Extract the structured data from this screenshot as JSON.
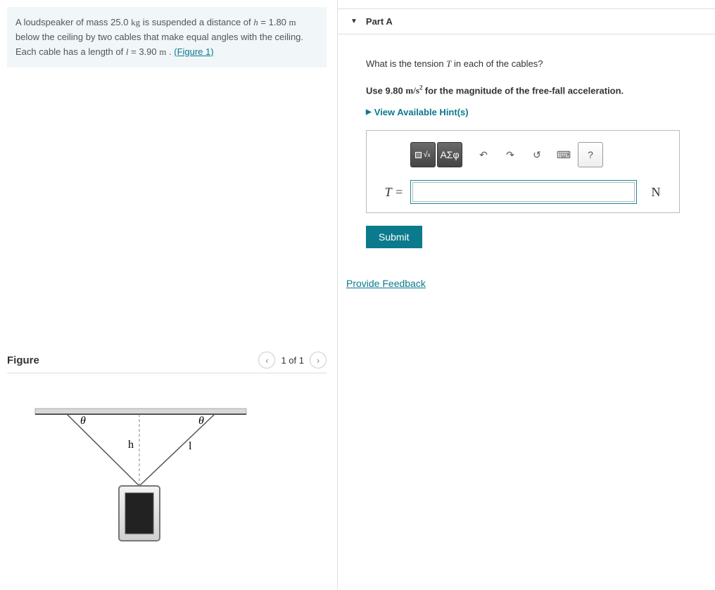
{
  "problem": {
    "prefix": "A loudspeaker of mass ",
    "mass": "25.0",
    "mass_unit": "kg",
    "mid1": " is suspended a distance of ",
    "h_var": "h",
    "h_eq": " = ",
    "h_val": "1.80",
    "h_unit": "m",
    "mid2": " below the ceiling by two cables that make equal angles with the ceiling. Each cable has a length of ",
    "l_var": "l",
    "l_eq": " = ",
    "l_val": "3.90",
    "l_unit": "m",
    "tail": " . ",
    "figure_link": "(Figure 1)"
  },
  "figure": {
    "title": "Figure",
    "nav_text": "1 of 1",
    "labels": {
      "theta_left": "θ",
      "theta_right": "θ",
      "h": "h",
      "l": "l"
    }
  },
  "partA": {
    "title": "Part A",
    "question_prefix": "What is the tension ",
    "tension_var": "T",
    "question_suffix": " in each of the cables?",
    "use_prefix": "Use ",
    "g_val": "9.80",
    "g_unit_a": "m",
    "g_unit_b": "s",
    "g_sup": "2",
    "use_suffix": " for the magnitude of the free-fall acceleration.",
    "hints": "View Available Hint(s)",
    "answer_var": "T =",
    "answer_unit": "N",
    "submit": "Submit"
  },
  "toolbar": {
    "templates": "x√a",
    "greek": "ΑΣφ",
    "help": "?"
  },
  "feedback": "Provide Feedback"
}
